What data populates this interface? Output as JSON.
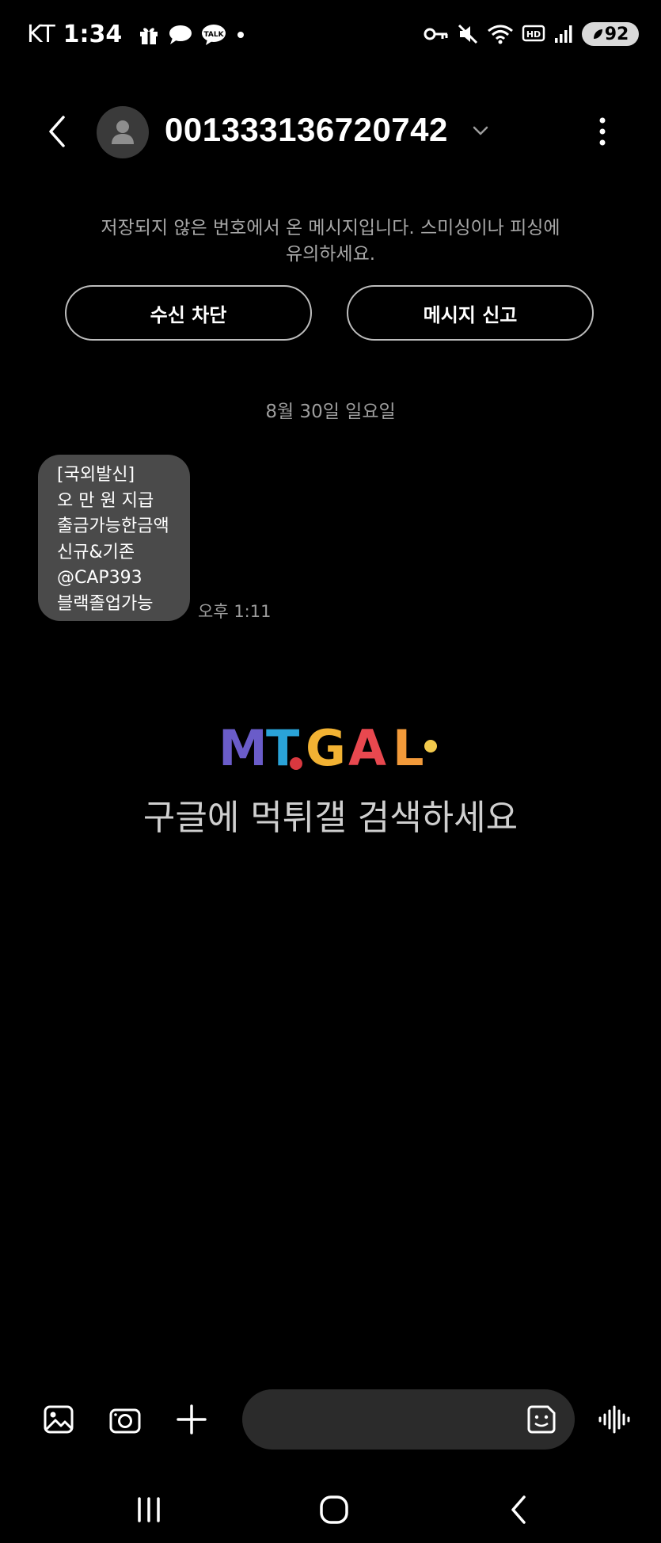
{
  "status_bar": {
    "carrier": "KT",
    "time": "1:34",
    "left_icons": [
      "gift-icon",
      "chat-bubble-icon",
      "kakaotalk-icon",
      "notification-dot-icon"
    ],
    "kakaotalk_label": "TALK",
    "right_icons": [
      "vpn-key-icon",
      "mute-icon",
      "wifi-icon",
      "hd-voice-icon",
      "signal-icon"
    ],
    "hd_label": "HD",
    "battery": "92"
  },
  "header": {
    "contact_number": "001333136720742",
    "back_icon": "chevron-left-icon",
    "avatar_icon": "person-icon",
    "more_icon": "more-vert-icon"
  },
  "warning": {
    "line1": "저장되지 않은 번호에서 온 메시지입니다. 스미싱이나 피싱에",
    "line2": "유의하세요.",
    "block_label": "수신 차단",
    "report_label": "메시지 신고"
  },
  "conversation": {
    "date": "8월 30일 일요일",
    "messages": [
      {
        "lines": [
          "[국외발신]",
          "오 만 원 지급",
          "출금가능한금액",
          "신규&기존",
          "@CAP393",
          "블랙졸업가능"
        ],
        "time": "오후 1:11"
      }
    ]
  },
  "watermark": {
    "logo_text": "MTGAL",
    "logo_colors": [
      "#6a5cc9",
      "#2aa3d8",
      "#f2b233",
      "#e8484f",
      "#f29a3a"
    ],
    "caption": "구글에 먹튀갤 검색하세요"
  },
  "compose": {
    "icons": [
      "gallery-icon",
      "camera-icon",
      "plus-icon",
      "sticker-icon",
      "voice-record-icon"
    ],
    "placeholder": ""
  },
  "nav_bar": {
    "icons": [
      "recent-apps-icon",
      "home-icon",
      "back-icon"
    ]
  },
  "colors": {
    "background": "#000000",
    "bubble": "#4a4a4a",
    "secondary_text": "#9d9d9d",
    "compose_field": "#2b2b2b"
  }
}
